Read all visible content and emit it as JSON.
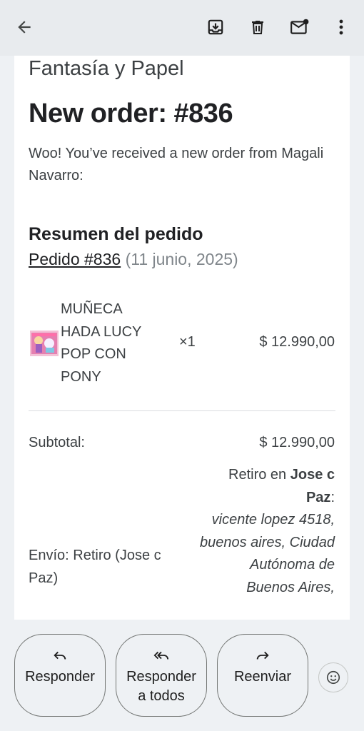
{
  "toolbar": {
    "back_icon": "arrow-back-icon",
    "archive_icon": "archive-icon",
    "delete_icon": "trash-icon",
    "mark_unread_icon": "mail-unread-icon",
    "more_icon": "more-vert-icon"
  },
  "email": {
    "store_name": "Fantasía y Papel",
    "title": "New order: #836",
    "intro": "Woo! You’ve received a new order from Magali Navarro:",
    "summary_heading": "Resumen del pedido",
    "order_link": "Pedido #836",
    "order_date": " (11 junio, 2025)",
    "item": {
      "name": "MUÑECA HADA LUCY POP CON PONY",
      "qty": "×1",
      "price": "$ 12.990,00"
    },
    "subtotal_label": "Subtotal:",
    "subtotal_value": "$ 12.990,00",
    "shipping_label": "Envío: Retiro (Jose c Paz)",
    "shipping": {
      "prefix": "Retiro en ",
      "place": "Jose c Paz",
      "colon": ":",
      "address": "vicente lopez 4518, buenos aires, Ciudad Autónoma de Buenos Aires,"
    }
  },
  "actions": {
    "reply": "Responder",
    "reply_all": "Responder a todos",
    "forward": "Reenviar",
    "emoji_icon": "emoji-smile-icon"
  },
  "colors": {
    "topbar": "#e8ebee",
    "page_bg": "#eef1f4",
    "card": "#ffffff"
  }
}
